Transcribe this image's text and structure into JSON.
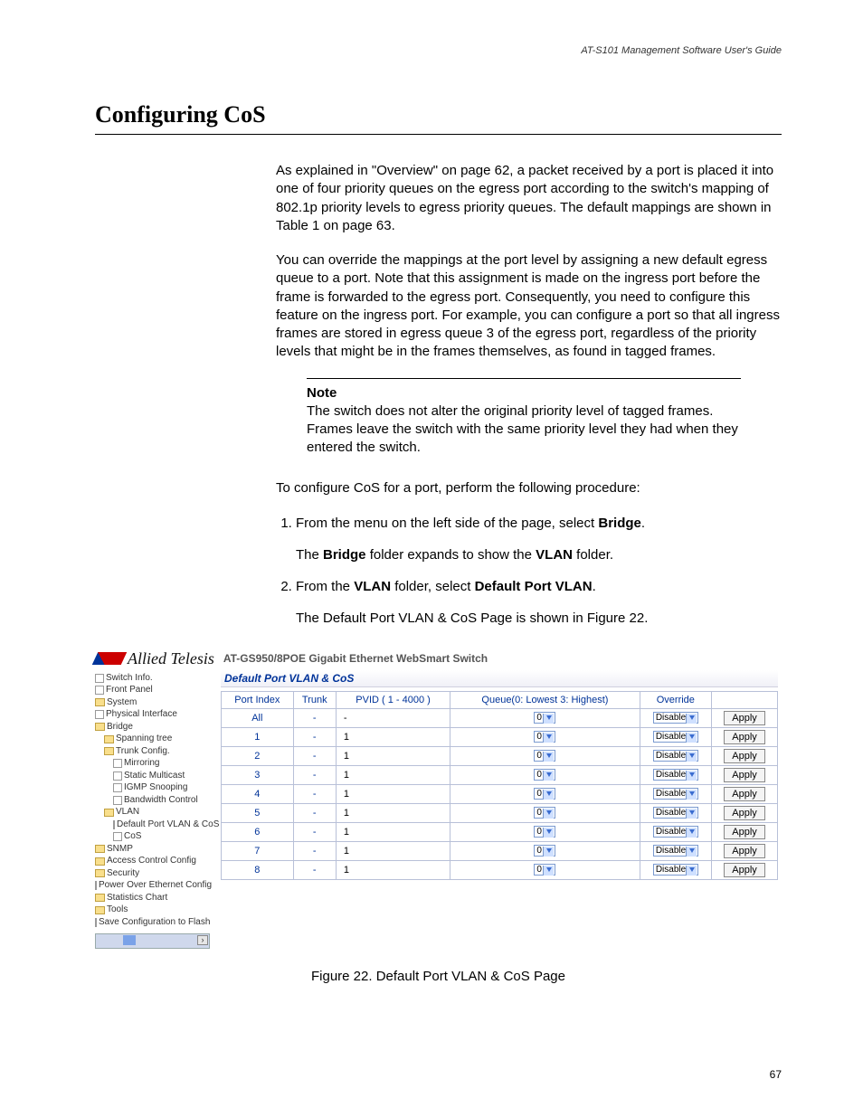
{
  "header": {
    "running": "AT-S101 Management Software User's Guide"
  },
  "section_title": "Configuring CoS",
  "paragraphs": {
    "p1": "As explained in \"Overview\" on page 62, a packet received by a port is placed it into one of four priority queues on the egress port according to the switch's mapping of 802.1p priority levels to egress priority queues. The default mappings are shown in Table 1 on page 63.",
    "p2": "You can override the mappings at the port level by assigning a new default egress queue to a port. Note that this assignment is made on the ingress port before the frame is forwarded to the egress port. Consequently, you need to configure this feature on the ingress port. For example, you can configure a port so that all ingress frames are stored in egress queue 3 of the egress port, regardless of the priority levels that might be in the frames themselves, as found in tagged frames.",
    "p3": "To configure CoS for a port, perform the following procedure:"
  },
  "note": {
    "label": "Note",
    "text": "The switch does not alter the original priority level of tagged frames. Frames leave the switch with the same priority level they had when they entered the switch."
  },
  "steps": {
    "s1_pre": "From the menu on the left side of the page, select ",
    "s1_bold": "Bridge",
    "s1_post": ".",
    "s1_sub_pre": "The ",
    "s1_sub_b1": "Bridge",
    "s1_sub_mid": " folder expands to show the ",
    "s1_sub_b2": "VLAN",
    "s1_sub_post": " folder.",
    "s2_pre": "From the ",
    "s2_b1": "VLAN",
    "s2_mid": " folder, select ",
    "s2_b2": "Default Port VLAN",
    "s2_post": ".",
    "s2_sub": "The Default Port VLAN & CoS Page is shown in Figure 22."
  },
  "embed": {
    "logo_text": "Allied Telesis",
    "model": "AT-GS950/8POE Gigabit Ethernet WebSmart Switch",
    "pane_title": "Default Port VLAN & CoS",
    "headers": {
      "port": "Port Index",
      "trunk": "Trunk",
      "pvid": "PVID ( 1 - 4000 )",
      "queue": "Queue(0: Lowest 3: Highest)",
      "override": "Override",
      "apply": "Apply"
    },
    "queue_value": "0",
    "override_value": "Disable",
    "rows": [
      {
        "port": "All",
        "trunk": "-",
        "pvid": "-"
      },
      {
        "port": "1",
        "trunk": "-",
        "pvid": "1"
      },
      {
        "port": "2",
        "trunk": "-",
        "pvid": "1"
      },
      {
        "port": "3",
        "trunk": "-",
        "pvid": "1"
      },
      {
        "port": "4",
        "trunk": "-",
        "pvid": "1"
      },
      {
        "port": "5",
        "trunk": "-",
        "pvid": "1"
      },
      {
        "port": "6",
        "trunk": "-",
        "pvid": "1"
      },
      {
        "port": "7",
        "trunk": "-",
        "pvid": "1"
      },
      {
        "port": "8",
        "trunk": "-",
        "pvid": "1"
      }
    ],
    "nav": [
      {
        "label": "Switch Info.",
        "icon": "doc",
        "indent": 0
      },
      {
        "label": "Front Panel",
        "icon": "doc",
        "indent": 0
      },
      {
        "label": "System",
        "icon": "fld",
        "indent": 0
      },
      {
        "label": "Physical Interface",
        "icon": "doc",
        "indent": 0
      },
      {
        "label": "Bridge",
        "icon": "fld",
        "indent": 0
      },
      {
        "label": "Spanning tree",
        "icon": "fld",
        "indent": 1
      },
      {
        "label": "Trunk Config.",
        "icon": "fld",
        "indent": 1
      },
      {
        "label": "Mirroring",
        "icon": "doc",
        "indent": 2
      },
      {
        "label": "Static Multicast",
        "icon": "doc",
        "indent": 2
      },
      {
        "label": "IGMP Snooping",
        "icon": "doc",
        "indent": 2
      },
      {
        "label": "Bandwidth Control",
        "icon": "doc",
        "indent": 2
      },
      {
        "label": "VLAN",
        "icon": "fld",
        "indent": 1
      },
      {
        "label": "Default Port VLAN & CoS",
        "icon": "doc",
        "indent": 2
      },
      {
        "label": "CoS",
        "icon": "doc",
        "indent": 2
      },
      {
        "label": "SNMP",
        "icon": "fld",
        "indent": 0
      },
      {
        "label": "Access Control Config",
        "icon": "fld",
        "indent": 0
      },
      {
        "label": "Security",
        "icon": "fld",
        "indent": 0
      },
      {
        "label": "Power Over Ethernet Config",
        "icon": "doc",
        "indent": 0
      },
      {
        "label": "Statistics Chart",
        "icon": "fld",
        "indent": 0
      },
      {
        "label": "Tools",
        "icon": "fld",
        "indent": 0
      },
      {
        "label": "Save Configuration to Flash",
        "icon": "doc",
        "indent": 0
      }
    ]
  },
  "figure_caption": "Figure 22. Default Port VLAN & CoS Page",
  "page_number": "67"
}
